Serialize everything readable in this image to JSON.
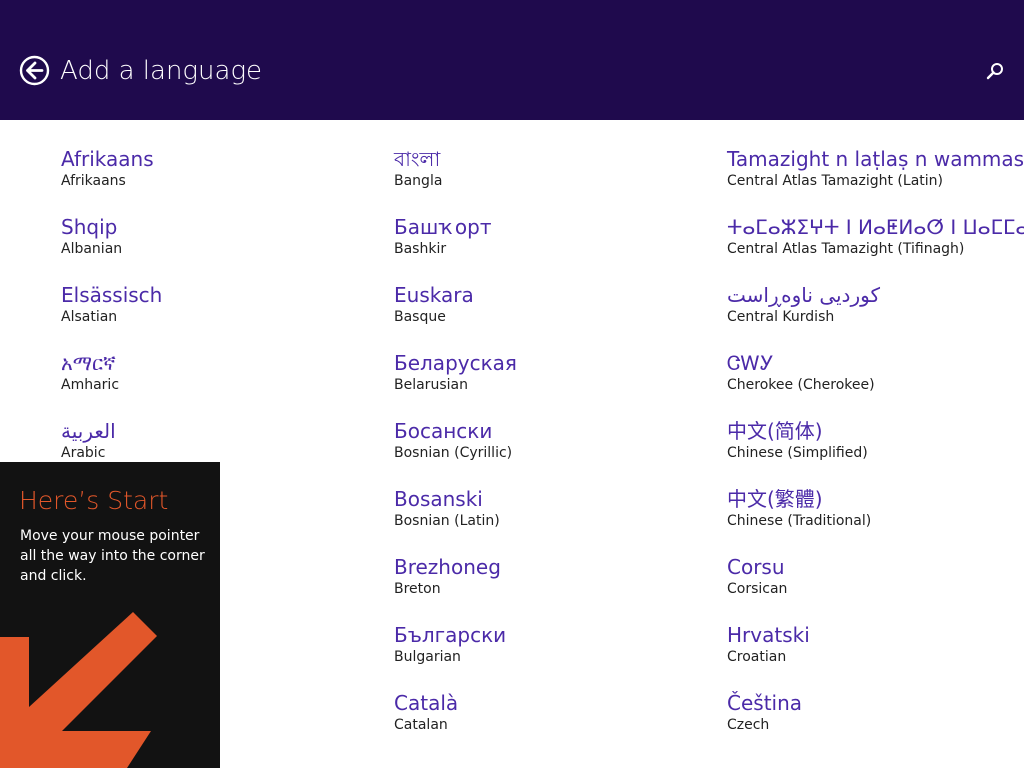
{
  "header": {
    "title": "Add a language",
    "back_icon": "back-arrow-circle-icon",
    "search_icon": "search-icon"
  },
  "languages": [
    {
      "native": "Afrikaans",
      "english": "Afrikaans"
    },
    {
      "native": "Shqip",
      "english": "Albanian"
    },
    {
      "native": "Elsässisch",
      "english": "Alsatian"
    },
    {
      "native": "አማርኛ",
      "english": "Amharic"
    },
    {
      "native": "العربية",
      "english": "Arabic"
    },
    {
      "native": "বাংলা",
      "english": "Bangla"
    },
    {
      "native": "Башҡорт",
      "english": "Bashkir"
    },
    {
      "native": "Euskara",
      "english": "Basque"
    },
    {
      "native": "Беларуская",
      "english": "Belarusian"
    },
    {
      "native": "Босански",
      "english": "Bosnian (Cyrillic)"
    },
    {
      "native": "Bosanski",
      "english": "Bosnian (Latin)"
    },
    {
      "native": "Brezhoneg",
      "english": "Breton"
    },
    {
      "native": "Български",
      "english": "Bulgarian"
    },
    {
      "native": "Català",
      "english": "Catalan"
    },
    {
      "native": "Tamazight n laṭlaṣ n wammas",
      "english": "Central Atlas Tamazight (Latin)"
    },
    {
      "native": "ⵜⴰⵎⴰⵣⵉⵖⵜ ⵏ ⵍⴰⵟⵍⴰⵚ ⵏ ⵡⴰⵎⵎⴰⵙ",
      "english": "Central Atlas Tamazight (Tifinagh)"
    },
    {
      "native": "كوردیی ناوەڕاست",
      "english": "Central Kurdish"
    },
    {
      "native": "ᏣᎳᎩ",
      "english": "Cherokee (Cherokee)"
    },
    {
      "native": "中文(简体)",
      "english": "Chinese (Simplified)"
    },
    {
      "native": "中文(繁體)",
      "english": "Chinese (Traditional)"
    },
    {
      "native": "Corsu",
      "english": "Corsican"
    },
    {
      "native": "Hrvatski",
      "english": "Croatian"
    },
    {
      "native": "Čeština",
      "english": "Czech"
    }
  ],
  "start_tip": {
    "title": "Here’s Start",
    "body": "Move your mouse pointer all the way into the corner and click.",
    "arrow_icon": "arrow-down-left-icon",
    "accent_color": "#e2572a"
  },
  "colors": {
    "header_bg": "#1f0a4d",
    "language_native": "#4b2aa8",
    "tip_bg": "#121212"
  }
}
